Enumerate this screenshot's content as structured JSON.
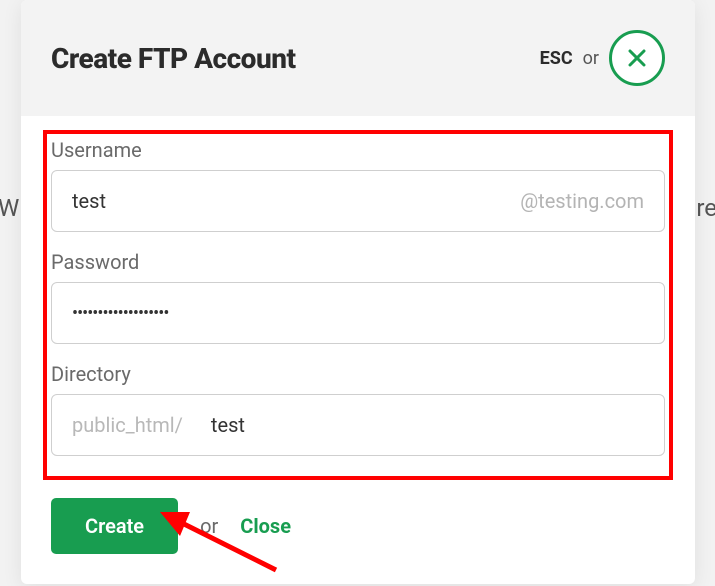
{
  "back": {
    "left": "W",
    "right": "re"
  },
  "header": {
    "title": "Create FTP Account",
    "esc": "ESC",
    "or": "or"
  },
  "fields": {
    "username": {
      "label": "Username",
      "value": "test",
      "suffix": "@testing.com"
    },
    "password": {
      "label": "Password",
      "mask": "•••••••••••••••••••"
    },
    "directory": {
      "label": "Directory",
      "prefix": "public_html/",
      "value": "test"
    }
  },
  "footer": {
    "create": "Create",
    "or": "or",
    "close": "Close"
  }
}
